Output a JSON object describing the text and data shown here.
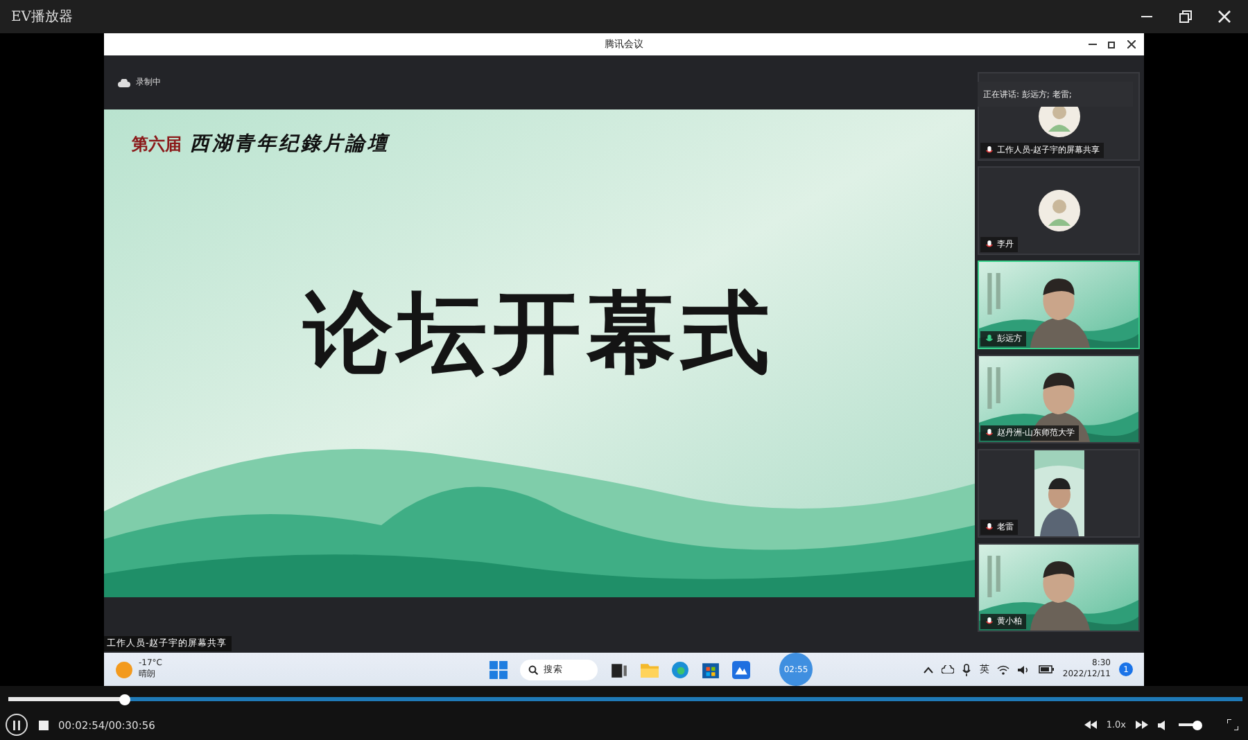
{
  "window": {
    "title": "EV播放器"
  },
  "meeting": {
    "title": "腾讯会议",
    "recording": "录制中",
    "speaking_banner": "正在讲话: 彭远方; 老雷;",
    "slide": {
      "edition": "第六届",
      "forum": "西湖青年纪錄片論壇",
      "headline": "论坛开幕式"
    },
    "share_label": "工作人员-赵子宇的屏幕共享",
    "participants": [
      {
        "name": "工作人员-赵子宇的屏幕共享",
        "kind": "avatar",
        "speaking": false
      },
      {
        "name": "李丹",
        "kind": "avatar",
        "speaking": false
      },
      {
        "name": "彭远方",
        "kind": "video",
        "speaking": true
      },
      {
        "name": "赵丹洲-山东师范大学",
        "kind": "video",
        "speaking": false
      },
      {
        "name": "老雷",
        "kind": "portrait",
        "speaking": false
      },
      {
        "name": "黄小柏",
        "kind": "video",
        "speaking": false
      }
    ]
  },
  "taskbar": {
    "temperature": "-17°C",
    "weather": "晴朗",
    "search": "搜索",
    "timer": "02:55",
    "ime": "英",
    "time": "8:30",
    "date": "2022/12/11",
    "notifications": "1"
  },
  "player": {
    "progress": {
      "level": 0.094
    },
    "time": "00:02:54/00:30:56",
    "speed": "1.0x",
    "volume": {
      "level": 0.9
    }
  }
}
